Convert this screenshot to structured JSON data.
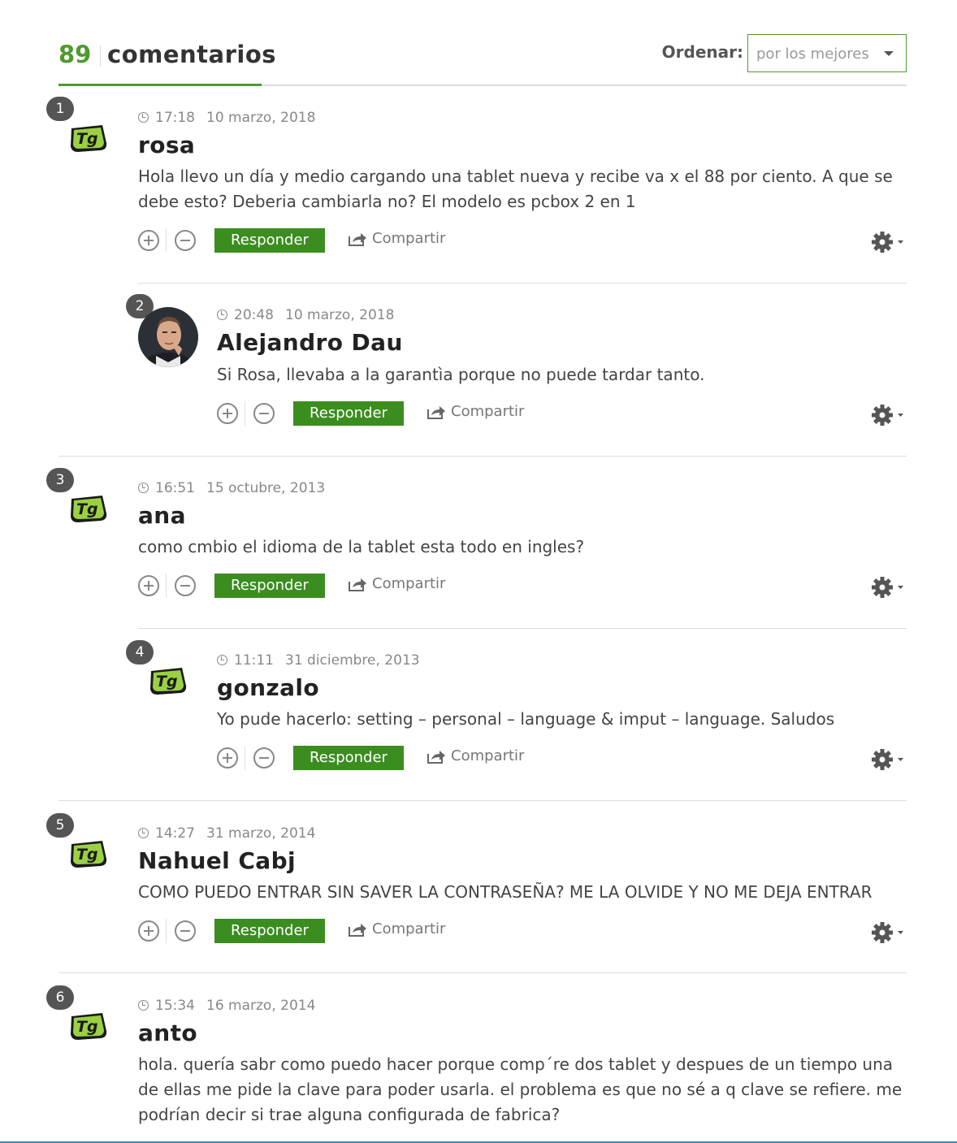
{
  "header": {
    "count": "89",
    "title": "comentarios",
    "sort_label": "Ordenar:",
    "sort_value": "por los mejores"
  },
  "actions": {
    "reply_label": "Responder",
    "share_label": "Compartir"
  },
  "colors": {
    "accent": "#4f9a2f",
    "reply_button": "#3b8d1f"
  },
  "comments": [
    {
      "number": "1",
      "time": "17:18",
      "date": "10 marzo, 2018",
      "author": "rosa",
      "text": "Hola llevo un día y medio cargando una tablet nueva y recibe va x el 88 por ciento. A que se debe esto? Deberia cambiarla no? El modelo es pcbox 2 en 1",
      "avatar": "tg-logo"
    },
    {
      "number": "2",
      "time": "20:48",
      "date": "10 marzo, 2018",
      "author": "Alejandro Dau",
      "text": "Si Rosa, llevaba a la garantìa porque no puede tardar tanto.",
      "avatar": "photo"
    },
    {
      "number": "3",
      "time": "16:51",
      "date": "15 octubre, 2013",
      "author": "ana",
      "text": "como cmbio el idioma de la tablet esta todo en ingles?",
      "avatar": "tg-logo"
    },
    {
      "number": "4",
      "time": "11:11",
      "date": "31 diciembre, 2013",
      "author": "gonzalo",
      "text": "Yo pude hacerlo: setting – personal – language & imput – language. Saludos",
      "avatar": "tg-logo"
    },
    {
      "number": "5",
      "time": "14:27",
      "date": "31 marzo, 2014",
      "author": "Nahuel Cabj",
      "text": "COMO PUEDO ENTRAR SIN SAVER LA CONTRASEÑA? ME LA OLVIDE Y NO ME DEJA ENTRAR",
      "avatar": "tg-logo"
    },
    {
      "number": "6",
      "time": "15:34",
      "date": "16 marzo, 2014",
      "author": "anto",
      "text": "hola. quería sabr como puedo hacer porque comp´re dos tablet y despues de un tiempo una de ellas me pide la clave para poder usarla. el problema es que no sé a q clave se refiere. me podrían decir si trae alguna configurada de fabrica?",
      "avatar": "tg-logo"
    }
  ]
}
